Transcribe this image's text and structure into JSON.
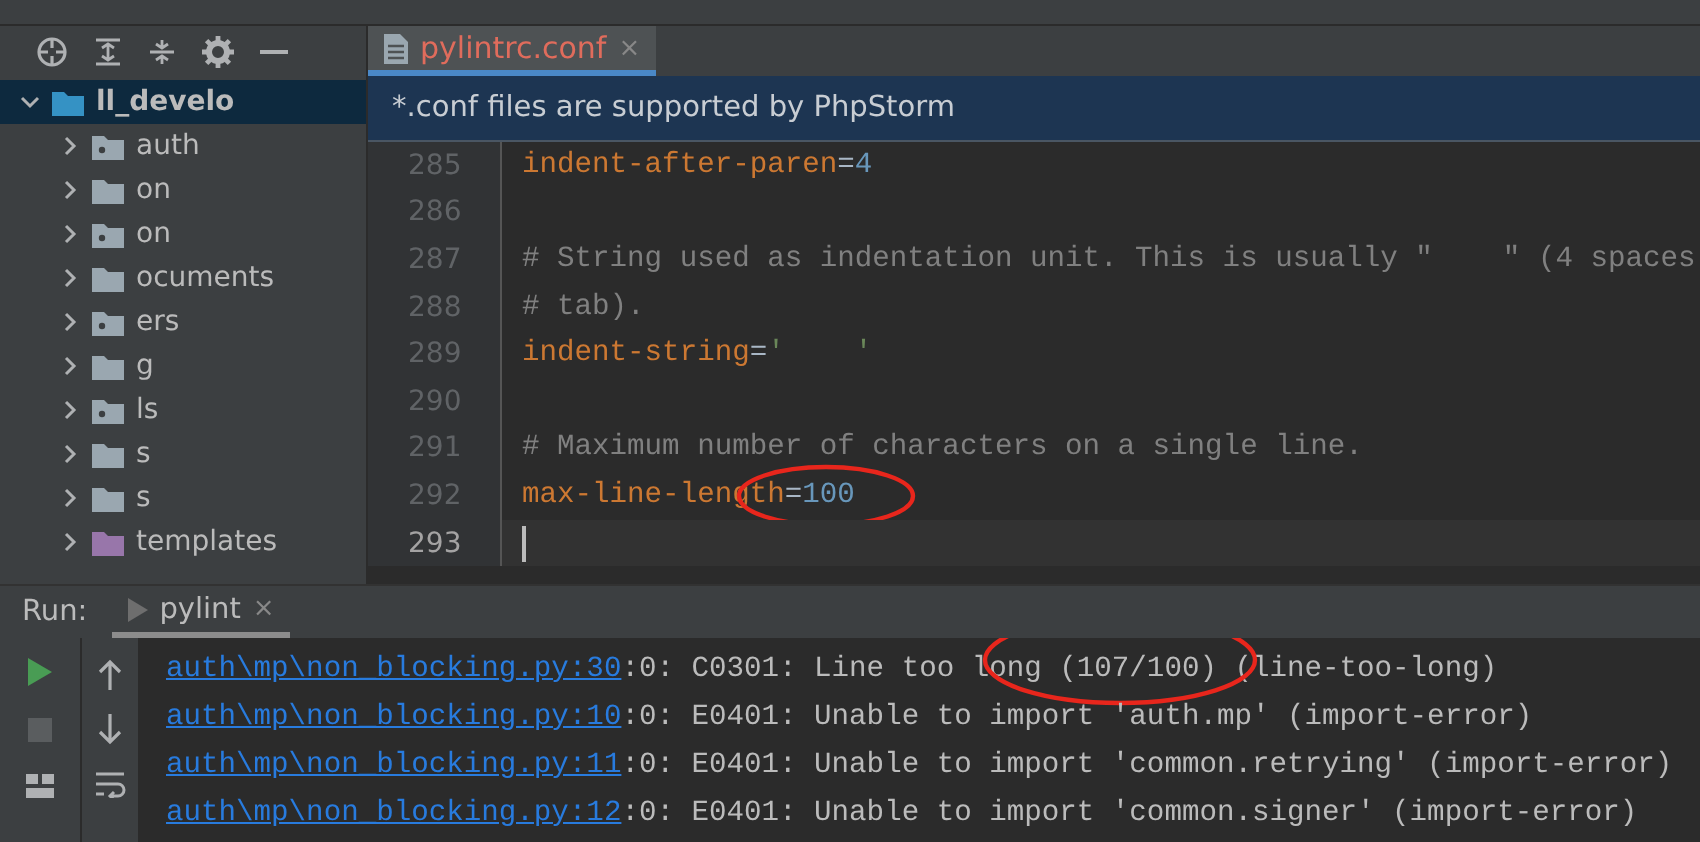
{
  "project_tree": {
    "root": {
      "label": "ll_develo",
      "expanded": true,
      "selected": true,
      "children": [
        {
          "label": "auth",
          "kind": "package",
          "expanded": false
        },
        {
          "label": "on",
          "kind": "folder",
          "expanded": false
        },
        {
          "label": "on",
          "kind": "package",
          "expanded": false
        },
        {
          "label": "ocuments",
          "kind": "folder",
          "expanded": false
        },
        {
          "label": "ers",
          "kind": "package",
          "expanded": false
        },
        {
          "label": "g",
          "kind": "folder",
          "expanded": false
        },
        {
          "label": "ls",
          "kind": "package",
          "expanded": false
        },
        {
          "label": "s",
          "kind": "folder",
          "expanded": false
        },
        {
          "label": "s",
          "kind": "folder",
          "expanded": false
        },
        {
          "label": "templates",
          "kind": "templates",
          "expanded": false
        }
      ]
    }
  },
  "tabs": [
    {
      "label": "pylintrc.conf",
      "selected": true,
      "close": "×"
    }
  ],
  "banner": "*.conf files are supported by PhpStorm",
  "editor": {
    "lines": [
      {
        "number": "285",
        "current": false,
        "circled": false,
        "tokens": [
          {
            "kind": "key",
            "text": "indent-after-paren"
          },
          {
            "kind": "op",
            "text": "="
          },
          {
            "kind": "number",
            "text": "4"
          }
        ]
      },
      {
        "number": "286",
        "current": false,
        "circled": false
      },
      {
        "number": "287",
        "current": false,
        "circled": false,
        "tokens": [
          {
            "kind": "comment",
            "text": "# String used as indentation unit. This is usually \"    \" (4 spaces"
          }
        ]
      },
      {
        "number": "288",
        "current": false,
        "circled": false,
        "tokens": [
          {
            "kind": "comment",
            "text": "# tab)."
          }
        ]
      },
      {
        "number": "289",
        "current": false,
        "circled": false,
        "tokens": [
          {
            "kind": "key",
            "text": "indent-string"
          },
          {
            "kind": "op",
            "text": "="
          },
          {
            "kind": "string",
            "text": "'    '"
          }
        ]
      },
      {
        "number": "290",
        "current": false,
        "circled": false
      },
      {
        "number": "291",
        "current": false,
        "circled": false,
        "tokens": [
          {
            "kind": "comment",
            "text": "# Maximum number of characters on a single line."
          }
        ]
      },
      {
        "number": "292",
        "current": false,
        "circled": true,
        "tokens": [
          {
            "kind": "key",
            "text": "max-line-length"
          },
          {
            "kind": "op",
            "text": "="
          },
          {
            "kind": "number",
            "text": "100"
          }
        ]
      },
      {
        "number": "293",
        "current": true,
        "circled": false
      }
    ]
  },
  "run": {
    "label": "Run:",
    "tabs": [
      {
        "label": "pylint",
        "selected": true,
        "close": "×"
      }
    ],
    "output": [
      {
        "link": "auth\\mp\\non_blocking.py:30",
        "text": ":0: C0301: Line too long (107/100) (line-too-long)",
        "circled": true
      },
      {
        "link": "auth\\mp\\non_blocking.py:10",
        "text": ":0: E0401: Unable to import 'auth.mp' (import-error)",
        "circled": false
      },
      {
        "link": "auth\\mp\\non_blocking.py:11",
        "text": ":0: E0401: Unable to import 'common.retrying' (import-error)",
        "circled": false
      },
      {
        "link": "auth\\mp\\non_blocking.py:12",
        "text": ":0: E0401: Unable to import 'common.signer' (import-error)",
        "circled": false
      }
    ]
  }
}
